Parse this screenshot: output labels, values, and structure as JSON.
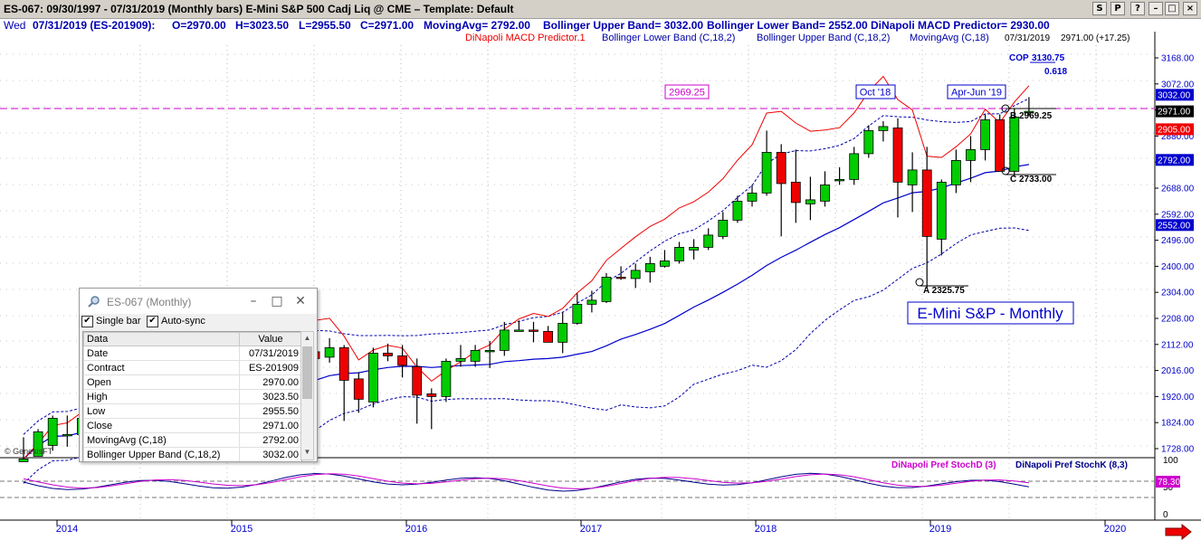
{
  "window": {
    "title": "ES-067:  09/30/1997 - 07/31/2019  (Monthly bars)   E-Mini S&P 500 Cadj Liq @ CME  –  Template: Default",
    "buttons": [
      "S",
      "P",
      "–",
      "□",
      "×"
    ]
  },
  "info_line": {
    "day": "Wed",
    "date_contract": "07/31/2019 (ES-201909):",
    "open": "O=2970.00",
    "high": "H=3023.50",
    "low": "L=2955.50",
    "close": "C=2971.00",
    "moving_avg": "MovingAvg= 2792.00",
    "bb_upper": "Bollinger Upper Band= 3032.00",
    "bb_lower": "Bollinger Lower Band= 2552.00",
    "dinapoli": "DiNapoli MACD Predictor= 2930.00"
  },
  "legend": {
    "macd": "DiNapoli MACD Predictor.1",
    "bb_lower": "Bollinger Lower Band (C,18,2)",
    "bb_upper": "Bollinger Upper Band (C,18,2)",
    "ma": "MovingAvg (C,18)",
    "last_date": "07/31/2019",
    "last_close": "2971.00 (+17.25)"
  },
  "colors": {
    "up_candle": "#00cc00",
    "down_candle": "#ee0000",
    "moving_avg": "#0000cc",
    "bollinger": "#0000aa",
    "macd": "#ee0000",
    "stoch_d": "#cc00cc",
    "stoch_k": "#000088",
    "dashed_level": "#cc00cc",
    "axis_text": "#0000cc"
  },
  "annotations": {
    "level_label": "2969.25",
    "oct18": "Oct '18",
    "aprjun19": "Apr-Jun '19",
    "cop_label": "COP",
    "cop_value": "3130.75",
    "cop_ratio": "0.618",
    "point_a": "A 2325.75",
    "point_b": "B 2969.25",
    "point_c": "C 2733.00",
    "big_label": "E-Mini S&P - Monthly",
    "copyright": "© GenesisFT"
  },
  "price_axis": {
    "ticks": [
      "3168.00",
      "3072.00",
      "2976.00",
      "2880.00",
      "2784.00",
      "2688.00",
      "2592.00",
      "2496.00",
      "2400.00",
      "2304.00",
      "2208.00",
      "2112.00",
      "2016.00",
      "1920.00",
      "1824.00",
      "1728.00"
    ],
    "markers": [
      {
        "text": "3032.00",
        "bg": "#0000cc"
      },
      {
        "text": "2971.00",
        "bg": "#000000"
      },
      {
        "text": "2905.00",
        "bg": "#ee0000"
      },
      {
        "text": "2792.00",
        "bg": "#0000cc"
      },
      {
        "text": "2552.00",
        "bg": "#0000cc"
      }
    ]
  },
  "stoch_panel": {
    "label_d": "DiNapoli Pref StochD (3)",
    "label_k": "DiNapoli Pref StochK (8,3)",
    "value": "78.30",
    "ticks": [
      "100",
      "50",
      "0"
    ]
  },
  "time_axis": {
    "years": [
      "2014",
      "2015",
      "2016",
      "2017",
      "2018",
      "2019",
      "2020"
    ]
  },
  "data_window": {
    "title": "ES-067 (Monthly)",
    "single_bar": "Single bar",
    "auto_sync": "Auto-sync",
    "col_data": "Data",
    "col_value": "Value",
    "rows": [
      [
        "Date",
        "07/31/2019"
      ],
      [
        "Contract",
        "ES-201909"
      ],
      [
        "Open",
        "2970.00"
      ],
      [
        "High",
        "3023.50"
      ],
      [
        "Low",
        "2955.50"
      ],
      [
        "Close",
        "2971.00"
      ],
      [
        "MovingAvg (C,18)",
        "2792.00"
      ],
      [
        "Bollinger Upper Band (C,18,2)",
        "3032.00"
      ]
    ]
  },
  "chart_data": {
    "type": "candlestick",
    "title": "ES-067: 09/30/1997 - 07/31/2019 (Monthly bars) E-Mini S&P 500 Cadj Liq @ CME",
    "ylim": [
      1680,
      3230
    ],
    "x_start": "2013-10",
    "months": [
      "2013-10",
      "2013-11",
      "2013-12",
      "2014-01",
      "2014-02",
      "2014-03",
      "2014-04",
      "2014-05",
      "2014-06",
      "2014-07",
      "2014-08",
      "2014-09",
      "2014-10",
      "2014-11",
      "2014-12",
      "2015-01",
      "2015-02",
      "2015-03",
      "2015-04",
      "2015-05",
      "2015-06",
      "2015-07",
      "2015-08",
      "2015-09",
      "2015-10",
      "2015-11",
      "2015-12",
      "2016-01",
      "2016-02",
      "2016-03",
      "2016-04",
      "2016-05",
      "2016-06",
      "2016-07",
      "2016-08",
      "2016-09",
      "2016-10",
      "2016-11",
      "2016-12",
      "2017-01",
      "2017-02",
      "2017-03",
      "2017-04",
      "2017-05",
      "2017-06",
      "2017-07",
      "2017-08",
      "2017-09",
      "2017-10",
      "2017-11",
      "2017-12",
      "2018-01",
      "2018-02",
      "2018-03",
      "2018-04",
      "2018-05",
      "2018-06",
      "2018-07",
      "2018-08",
      "2018-09",
      "2018-10",
      "2018-11",
      "2018-12",
      "2019-01",
      "2019-02",
      "2019-03",
      "2019-04",
      "2019-05",
      "2019-06",
      "2019-07"
    ],
    "open": [
      1680,
      1700,
      1740,
      1780,
      1780,
      1840,
      1860,
      1880,
      1920,
      1950,
      1930,
      1990,
      1960,
      2010,
      2050,
      2045,
      2000,
      2105,
      2060,
      2100,
      2085,
      2065,
      2100,
      1985,
      1900,
      2080,
      2070,
      2030,
      1930,
      1920,
      2050,
      2050,
      2090,
      2090,
      2165,
      2165,
      2160,
      2120,
      2190,
      2260,
      2270,
      2360,
      2355,
      2380,
      2400,
      2420,
      2460,
      2470,
      2510,
      2570,
      2640,
      2670,
      2820,
      2710,
      2630,
      2640,
      2715,
      2720,
      2815,
      2900,
      2910,
      2700,
      2755,
      2500,
      2700,
      2790,
      2830,
      2940,
      2750,
      2970
    ],
    "high": [
      1770,
      1800,
      1850,
      1850,
      1860,
      1890,
      1900,
      1930,
      1965,
      1990,
      2020,
      2025,
      2050,
      2075,
      2090,
      2080,
      2120,
      2120,
      2125,
      2135,
      2130,
      2135,
      2110,
      2010,
      2100,
      2115,
      2110,
      2060,
      1950,
      2060,
      2110,
      2110,
      2125,
      2195,
      2200,
      2195,
      2180,
      2230,
      2300,
      2310,
      2375,
      2400,
      2410,
      2435,
      2460,
      2490,
      2500,
      2540,
      2600,
      2660,
      2700,
      2900,
      2850,
      2830,
      2730,
      2750,
      2765,
      2840,
      2920,
      2935,
      2945,
      2820,
      2840,
      2720,
      2830,
      2880,
      2960,
      2960,
      2980,
      3023.5
    ],
    "low": [
      1680,
      1700,
      1720,
      1735,
      1740,
      1800,
      1810,
      1860,
      1900,
      1910,
      1920,
      1945,
      1850,
      1990,
      1985,
      1970,
      1990,
      2040,
      2060,
      2065,
      2050,
      2045,
      1830,
      1860,
      1880,
      2050,
      1990,
      1820,
      1800,
      1900,
      2030,
      2030,
      2025,
      2070,
      2160,
      2120,
      2120,
      2080,
      2185,
      2230,
      2265,
      2350,
      2320,
      2340,
      2395,
      2410,
      2425,
      2460,
      2500,
      2560,
      2620,
      2660,
      2510,
      2560,
      2570,
      2620,
      2700,
      2700,
      2800,
      2860,
      2580,
      2600,
      2320,
      2440,
      2670,
      2710,
      2790,
      2750,
      2730,
      2955.5
    ],
    "close": [
      1690,
      1790,
      1840,
      1780,
      1840,
      1860,
      1880,
      1920,
      1950,
      1930,
      2000,
      1975,
      2010,
      2050,
      2045,
      1985,
      2100,
      2060,
      2080,
      2100,
      2060,
      2100,
      1980,
      1910,
      2080,
      2070,
      2035,
      1925,
      1920,
      2050,
      2060,
      2090,
      2090,
      2165,
      2165,
      2160,
      2120,
      2190,
      2260,
      2275,
      2360,
      2355,
      2385,
      2410,
      2420,
      2470,
      2470,
      2515,
      2570,
      2640,
      2670,
      2820,
      2705,
      2635,
      2645,
      2700,
      2720,
      2815,
      2900,
      2915,
      2710,
      2755,
      2510,
      2710,
      2790,
      2830,
      2940,
      2750,
      2950,
      2971
    ]
  }
}
